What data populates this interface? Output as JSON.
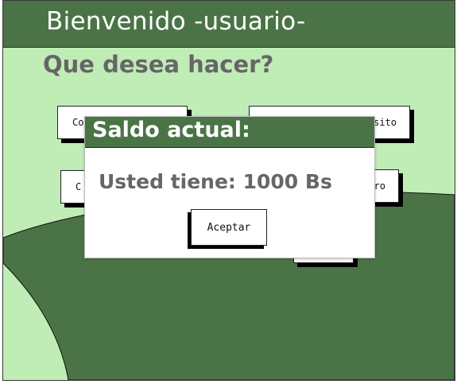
{
  "header": {
    "title": "Bienvenido -usuario-"
  },
  "main": {
    "question": "Que desea hacer?",
    "options": [
      {
        "label": "Co"
      },
      {
        "label": "sito"
      },
      {
        "label": "C"
      },
      {
        "label": "ro"
      },
      {
        "label": ""
      }
    ]
  },
  "dialog": {
    "title": "Saldo actual:",
    "message": "Usted tiene: 1000 Bs",
    "accept_label": "Aceptar"
  },
  "colors": {
    "header_green": "#4b7446",
    "background_green": "#c0ecb6",
    "hill_green": "#4b7446",
    "text_gray": "#666666"
  }
}
